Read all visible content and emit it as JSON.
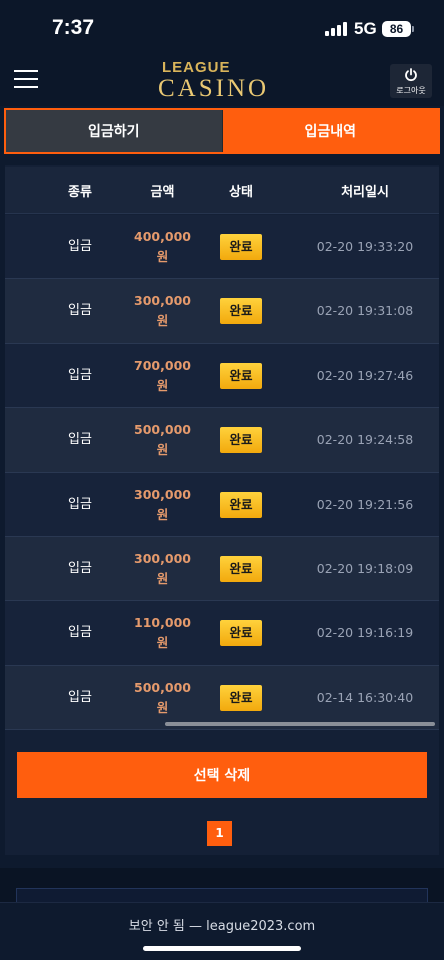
{
  "status_bar": {
    "time": "7:37",
    "network": "5G",
    "battery": "86"
  },
  "header": {
    "logo_top": "LEAGUE",
    "logo_bottom": "CASINO",
    "logout_label": "로그아웃"
  },
  "tabs": [
    {
      "label": "입금하기",
      "active": false
    },
    {
      "label": "입금내역",
      "active": true
    }
  ],
  "table": {
    "columns": [
      "종류",
      "금액",
      "상태",
      "처리일시"
    ],
    "rows": [
      {
        "type": "입금",
        "amount": "400,000",
        "unit": "원",
        "status": "완료",
        "date": "02-20 19:33:20"
      },
      {
        "type": "입금",
        "amount": "300,000",
        "unit": "원",
        "status": "완료",
        "date": "02-20 19:31:08"
      },
      {
        "type": "입금",
        "amount": "700,000",
        "unit": "원",
        "status": "완료",
        "date": "02-20 19:27:46"
      },
      {
        "type": "입금",
        "amount": "500,000",
        "unit": "원",
        "status": "완료",
        "date": "02-20 19:24:58"
      },
      {
        "type": "입금",
        "amount": "300,000",
        "unit": "원",
        "status": "완료",
        "date": "02-20 19:21:56"
      },
      {
        "type": "입금",
        "amount": "300,000",
        "unit": "원",
        "status": "완료",
        "date": "02-20 19:18:09"
      },
      {
        "type": "입금",
        "amount": "110,000",
        "unit": "원",
        "status": "완료",
        "date": "02-20 19:16:19"
      },
      {
        "type": "입금",
        "amount": "500,000",
        "unit": "원",
        "status": "완료",
        "date": "02-14 16:30:40"
      }
    ]
  },
  "actions": {
    "delete_label": "선택 삭제"
  },
  "pagination": {
    "current": "1"
  },
  "browser": {
    "address": "보안 안 됨 — league2023.com"
  },
  "colors": {
    "accent": "#ff5e0e",
    "badge": "#ffc526",
    "amount": "#e59a6c",
    "background": "#0e1a2e"
  }
}
